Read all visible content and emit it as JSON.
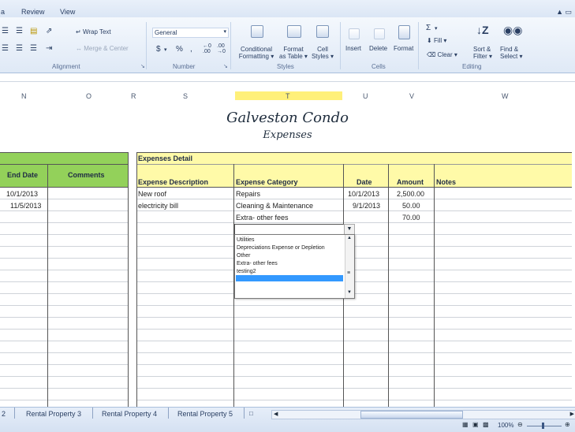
{
  "tabs": [
    "a",
    "Review",
    "View"
  ],
  "ribbon": {
    "wrap_text": "Wrap Text",
    "merge_center": "Merge & Center",
    "number_format": "General",
    "dollar": "$",
    "percent": "%",
    "comma": ",",
    "conditional_formatting": [
      "Conditional",
      "Formatting"
    ],
    "format_as_table": [
      "Format",
      "as Table"
    ],
    "cell_styles": [
      "Cell",
      "Styles"
    ],
    "insert": "Insert",
    "delete": "Delete",
    "format": "Format",
    "autosum": "Σ",
    "fill": "Fill",
    "clear": "Clear",
    "sort_filter": [
      "Sort &",
      "Filter"
    ],
    "find_select": [
      "Find &",
      "Select"
    ],
    "groups": [
      "Alignment",
      "Number",
      "Styles",
      "Cells",
      "Editing"
    ]
  },
  "columns": [
    "N",
    "O",
    "R",
    "S",
    "T",
    "U",
    "V",
    "W"
  ],
  "title": "Galveston Condo",
  "subtitle": "Expenses",
  "left_table": {
    "headers": [
      "End Date",
      "Comments"
    ],
    "rows": [
      [
        "10/1/2013",
        ""
      ],
      [
        "11/5/2013",
        ""
      ]
    ]
  },
  "expenses": {
    "section_title": "Expenses Detail",
    "headers": [
      "Expense Description",
      "Expense Category",
      "Date",
      "Amount",
      "Notes"
    ],
    "rows": [
      [
        "New roof",
        "Repairs",
        "10/1/2013",
        "2,500.00",
        ""
      ],
      [
        "electricity bill",
        "Cleaning & Maintenance",
        "9/1/2013",
        "50.00",
        ""
      ],
      [
        "",
        "Extra- other fees",
        "",
        "70.00",
        ""
      ]
    ]
  },
  "dropdown": {
    "options": [
      "Utilities",
      "Depreciations Expense or Depletion",
      "Other",
      "Extra- other fees",
      "testing2",
      ""
    ],
    "selected_index": 5
  },
  "sheet_tabs": [
    "2",
    "Rental Property 3",
    "Rental Property 4",
    "Rental Property 5"
  ],
  "zoom": "100%"
}
